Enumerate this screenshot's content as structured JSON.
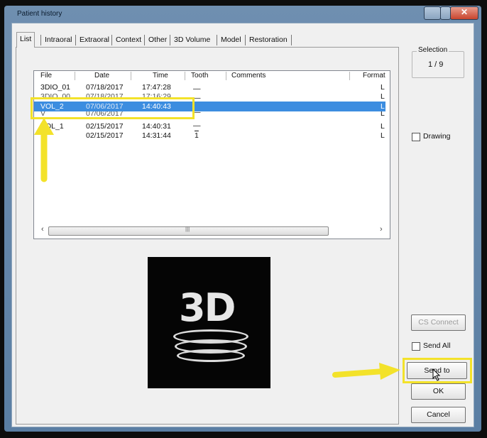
{
  "window": {
    "title": "Patient history"
  },
  "tabs": [
    "List",
    "Intraoral",
    "Extraoral",
    "Context",
    "Other",
    "3D Volume",
    "Model",
    "Restoration"
  ],
  "list": {
    "columns": [
      "File",
      "Date",
      "Time",
      "Tooth",
      "Comments",
      "Format"
    ],
    "rows": [
      {
        "file": "3DIO_01",
        "date": "07/18/2017",
        "time": "17:47:28",
        "tooth": "—",
        "comments": "",
        "format": "L"
      },
      {
        "file": "3DIO_00",
        "date": "07/18/2017",
        "time": "17:16:29",
        "tooth": "—",
        "comments": "",
        "format": "L"
      },
      {
        "file": "VOL_2",
        "date": "07/06/2017",
        "time": "14:40:43",
        "tooth": "",
        "comments": "",
        "format": "L"
      },
      {
        "file": "V",
        "date": "07/06/2017",
        "time": "",
        "tooth": "—",
        "comments": "",
        "format": "L"
      },
      {
        "file": "VOL_1",
        "date": "02/15/2017",
        "time": "14:40:31",
        "tooth": "—",
        "comments": "",
        "format": "L"
      },
      {
        "file": "R",
        "date": "02/15/2017",
        "time": "14:31:44",
        "tooth": "1",
        "comments": "",
        "format": "L"
      }
    ],
    "scroll_left": "‹",
    "scroll_right": "›",
    "scroll_thumb": "|||"
  },
  "preview": {
    "logo_text": "3D"
  },
  "selection": {
    "label": "Selection",
    "value": "1 / 9"
  },
  "drawing": {
    "label": "Drawing"
  },
  "buttons": {
    "cs_connect": "CS Connect",
    "send_to": "Send to",
    "ok": "OK",
    "cancel": "Cancel"
  },
  "send_all": {
    "label": "Send All"
  },
  "colors": {
    "selection_highlight": "#3c8de0",
    "annotation": "#f3e22a"
  }
}
